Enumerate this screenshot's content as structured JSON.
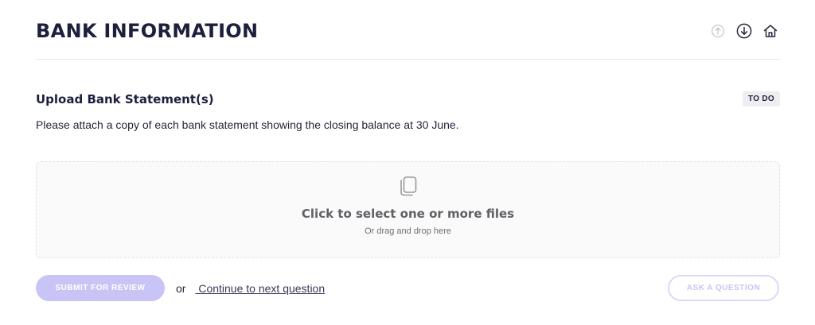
{
  "header": {
    "title": "BANK INFORMATION",
    "icons": [
      "arrow-up-circle-icon",
      "arrow-down-circle-icon",
      "home-icon"
    ]
  },
  "question": {
    "title": "Upload Bank Statement(s)",
    "status": "TO DO",
    "description": "Please attach a copy of each bank statement showing the closing balance at 30 June."
  },
  "dropzone": {
    "icon": "copy-files-icon",
    "primary_text": "Click to select one or more files",
    "secondary_text": "Or drag and drop here"
  },
  "footer": {
    "submit_label": "SUBMIT FOR REVIEW",
    "or_text": "or",
    "continue_label": " Continue to next question",
    "ask_label": "ASK A QUESTION"
  },
  "colors": {
    "title": "#1e1f3d",
    "accent_disabled": "#c9c4f6",
    "badge_bg": "#eeeef1",
    "divider": "#e6e6ea"
  }
}
